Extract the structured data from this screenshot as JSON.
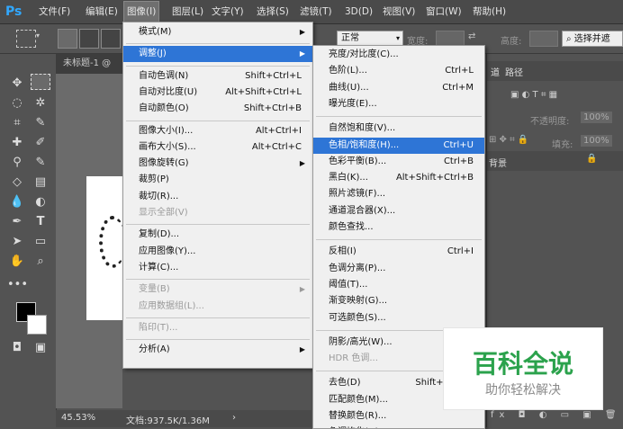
{
  "app": {
    "logo": "Ps"
  },
  "menubar": {
    "items": [
      "文件(F)",
      "编辑(E)",
      "图像(I)",
      "图层(L)",
      "文字(Y)",
      "选择(S)",
      "滤镜(T)",
      "3D(D)",
      "视图(V)",
      "窗口(W)",
      "帮助(H)"
    ],
    "active": "图像(I)"
  },
  "options_bar": {
    "style_label": "正常",
    "width_label": "宽度:",
    "height_label": "高度:",
    "select_button": "选择并遮"
  },
  "document": {
    "tab": "未标题-1 @",
    "zoom": "45.53%",
    "doc_info": "文档:937.5K/1.36M"
  },
  "panels": {
    "tabs": [
      "道",
      "路径"
    ],
    "opacity_label": "不透明度:",
    "opacity_value": "100%",
    "fill_label": "填充:",
    "fill_value": "100%",
    "layer_name": "背景"
  },
  "image_menu": [
    {
      "label": "模式(M)",
      "submenu": true
    },
    {
      "sep": true
    },
    {
      "label": "调整(J)",
      "submenu": true,
      "highlighted": true
    },
    {
      "sep": true
    },
    {
      "label": "自动色调(N)",
      "shortcut": "Shift+Ctrl+L"
    },
    {
      "label": "自动对比度(U)",
      "shortcut": "Alt+Shift+Ctrl+L"
    },
    {
      "label": "自动颜色(O)",
      "shortcut": "Shift+Ctrl+B"
    },
    {
      "sep": true
    },
    {
      "label": "图像大小(I)...",
      "shortcut": "Alt+Ctrl+I"
    },
    {
      "label": "画布大小(S)...",
      "shortcut": "Alt+Ctrl+C"
    },
    {
      "label": "图像旋转(G)",
      "submenu": true
    },
    {
      "label": "裁剪(P)"
    },
    {
      "label": "裁切(R)..."
    },
    {
      "label": "显示全部(V)",
      "disabled": true
    },
    {
      "sep": true
    },
    {
      "label": "复制(D)..."
    },
    {
      "label": "应用图像(Y)..."
    },
    {
      "label": "计算(C)..."
    },
    {
      "sep": true
    },
    {
      "label": "变量(B)",
      "submenu": true,
      "disabled": true
    },
    {
      "label": "应用数据组(L)...",
      "disabled": true
    },
    {
      "sep": true
    },
    {
      "label": "陷印(T)...",
      "disabled": true
    },
    {
      "sep": true
    },
    {
      "label": "分析(A)",
      "submenu": true
    }
  ],
  "adjust_menu": [
    {
      "label": "亮度/对比度(C)..."
    },
    {
      "label": "色阶(L)...",
      "shortcut": "Ctrl+L"
    },
    {
      "label": "曲线(U)...",
      "shortcut": "Ctrl+M"
    },
    {
      "label": "曝光度(E)..."
    },
    {
      "sep": true
    },
    {
      "label": "自然饱和度(V)..."
    },
    {
      "label": "色相/饱和度(H)...",
      "shortcut": "Ctrl+U",
      "highlighted": true
    },
    {
      "label": "色彩平衡(B)...",
      "shortcut": "Ctrl+B"
    },
    {
      "label": "黑白(K)...",
      "shortcut": "Alt+Shift+Ctrl+B"
    },
    {
      "label": "照片滤镜(F)..."
    },
    {
      "label": "通道混合器(X)..."
    },
    {
      "label": "颜色查找..."
    },
    {
      "sep": true
    },
    {
      "label": "反相(I)",
      "shortcut": "Ctrl+I"
    },
    {
      "label": "色调分离(P)..."
    },
    {
      "label": "阈值(T)..."
    },
    {
      "label": "渐变映射(G)..."
    },
    {
      "label": "可选颜色(S)..."
    },
    {
      "sep": true
    },
    {
      "label": "阴影/高光(W)..."
    },
    {
      "label": "HDR 色调...",
      "disabled": true
    },
    {
      "sep": true
    },
    {
      "label": "去色(D)",
      "shortcut": "Shift+Ctrl+U"
    },
    {
      "label": "匹配颜色(M)..."
    },
    {
      "label": "替换颜色(R)..."
    },
    {
      "label": "色调均化(Q)"
    }
  ],
  "watermark": {
    "title": "百科全说",
    "subtitle": "助你轻松解决"
  }
}
